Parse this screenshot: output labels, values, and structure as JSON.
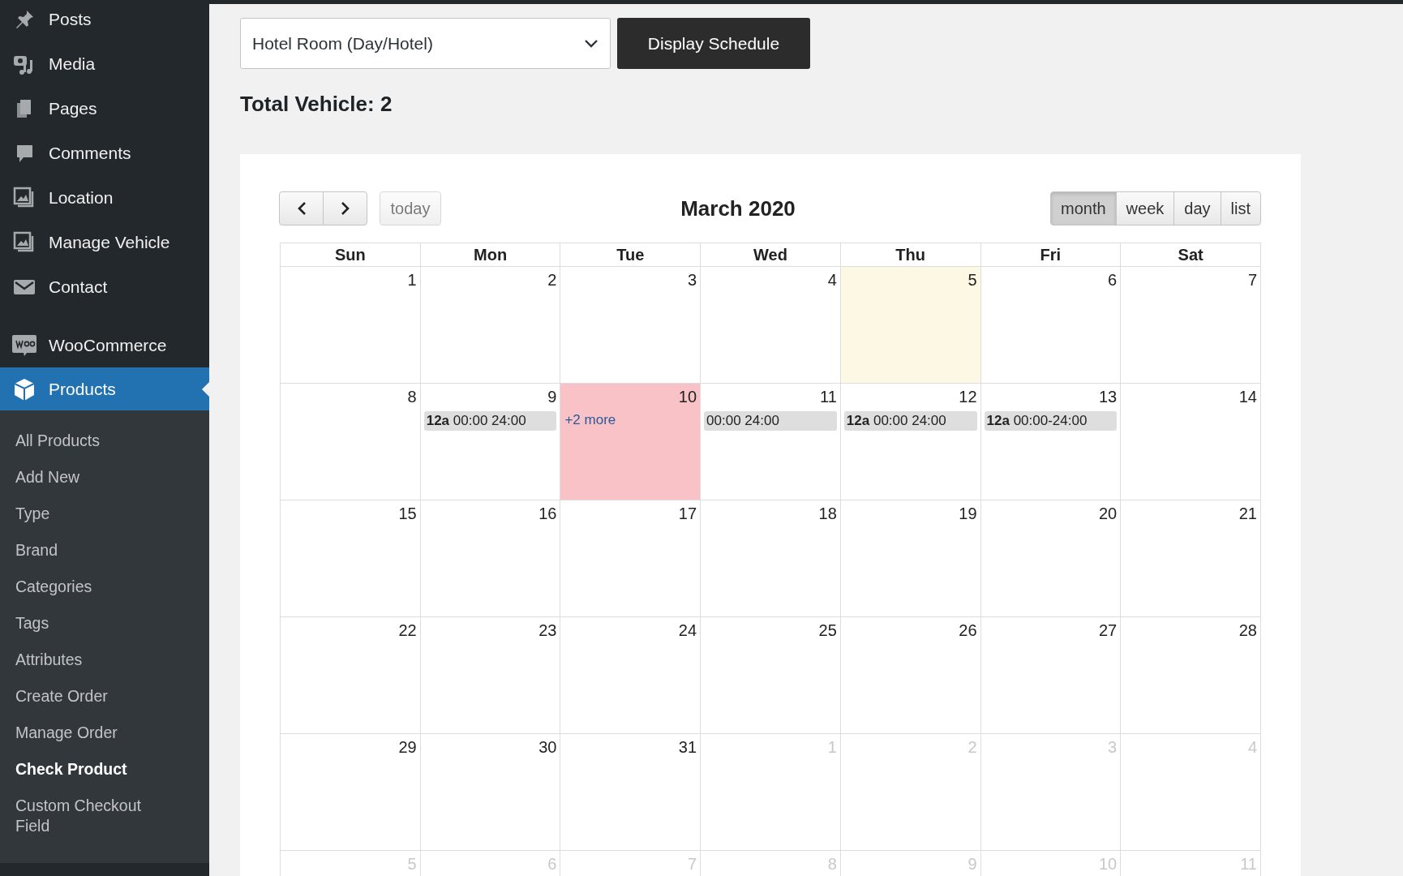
{
  "sidebar": {
    "menu": [
      {
        "label": "Posts",
        "selected": false
      },
      {
        "label": "Media",
        "selected": false
      },
      {
        "label": "Pages",
        "selected": false
      },
      {
        "label": "Comments",
        "selected": false
      },
      {
        "label": "Location",
        "selected": false
      },
      {
        "label": "Manage Vehicle",
        "selected": false
      },
      {
        "label": "Contact",
        "selected": false
      },
      {
        "label": "WooCommerce",
        "selected": false
      },
      {
        "label": "Products",
        "selected": true
      }
    ],
    "submenu": [
      {
        "label": "All Products",
        "selected": false
      },
      {
        "label": "Add New",
        "selected": false
      },
      {
        "label": "Type",
        "selected": false
      },
      {
        "label": "Brand",
        "selected": false
      },
      {
        "label": "Categories",
        "selected": false
      },
      {
        "label": "Tags",
        "selected": false
      },
      {
        "label": "Attributes",
        "selected": false
      },
      {
        "label": "Create Order",
        "selected": false
      },
      {
        "label": "Manage Order",
        "selected": false
      },
      {
        "label": "Check Product",
        "selected": true
      },
      {
        "label": "Custom Checkout Field",
        "selected": false
      }
    ]
  },
  "schedule": {
    "select": {
      "value": "Hotel Room (Day/Hotel)"
    },
    "button": "Display Schedule",
    "total": "Total Vehicle: 2"
  },
  "calendar": {
    "title": "March 2020",
    "today_button": "today",
    "views": [
      {
        "label": "month",
        "selected": true
      },
      {
        "label": "week",
        "selected": false
      },
      {
        "label": "day",
        "selected": false
      },
      {
        "label": "list",
        "selected": false
      }
    ],
    "weekdays": [
      "Sun",
      "Mon",
      "Tue",
      "Wed",
      "Thu",
      "Fri",
      "Sat"
    ],
    "weeks": [
      [
        {
          "day": "1",
          "other_month": false,
          "today": false,
          "booked": false
        },
        {
          "day": "2",
          "other_month": false,
          "today": false,
          "booked": false
        },
        {
          "day": "3",
          "other_month": false,
          "today": false,
          "booked": false
        },
        {
          "day": "4",
          "other_month": false,
          "today": false,
          "booked": false
        },
        {
          "day": "5",
          "other_month": false,
          "today": true,
          "booked": false
        },
        {
          "day": "6",
          "other_month": false,
          "today": false,
          "booked": false
        },
        {
          "day": "7",
          "other_month": false,
          "today": false,
          "booked": false
        }
      ],
      [
        {
          "day": "8",
          "other_month": false,
          "today": false,
          "booked": false
        },
        {
          "day": "9",
          "other_month": false,
          "today": false,
          "booked": false,
          "events": [
            {
              "time": "12a",
              "title": "00:00 24:00"
            }
          ]
        },
        {
          "day": "10",
          "other_month": false,
          "today": false,
          "booked": true,
          "more": "+2 more"
        },
        {
          "day": "11",
          "other_month": false,
          "today": false,
          "booked": false,
          "events": [
            {
              "title": "00:00 24:00"
            }
          ]
        },
        {
          "day": "12",
          "other_month": false,
          "today": false,
          "booked": false,
          "events": [
            {
              "time": "12a",
              "title": "00:00 24:00"
            }
          ]
        },
        {
          "day": "13",
          "other_month": false,
          "today": false,
          "booked": false,
          "events": [
            {
              "time": "12a",
              "title": "00:00-24:00"
            }
          ]
        },
        {
          "day": "14",
          "other_month": false,
          "today": false,
          "booked": false
        }
      ],
      [
        {
          "day": "15",
          "other_month": false,
          "today": false,
          "booked": false
        },
        {
          "day": "16",
          "other_month": false,
          "today": false,
          "booked": false
        },
        {
          "day": "17",
          "other_month": false,
          "today": false,
          "booked": false
        },
        {
          "day": "18",
          "other_month": false,
          "today": false,
          "booked": false
        },
        {
          "day": "19",
          "other_month": false,
          "today": false,
          "booked": false
        },
        {
          "day": "20",
          "other_month": false,
          "today": false,
          "booked": false
        },
        {
          "day": "21",
          "other_month": false,
          "today": false,
          "booked": false
        }
      ],
      [
        {
          "day": "22",
          "other_month": false,
          "today": false,
          "booked": false
        },
        {
          "day": "23",
          "other_month": false,
          "today": false,
          "booked": false
        },
        {
          "day": "24",
          "other_month": false,
          "today": false,
          "booked": false
        },
        {
          "day": "25",
          "other_month": false,
          "today": false,
          "booked": false
        },
        {
          "day": "26",
          "other_month": false,
          "today": false,
          "booked": false
        },
        {
          "day": "27",
          "other_month": false,
          "today": false,
          "booked": false
        },
        {
          "day": "28",
          "other_month": false,
          "today": false,
          "booked": false
        }
      ],
      [
        {
          "day": "29",
          "other_month": false,
          "today": false,
          "booked": false
        },
        {
          "day": "30",
          "other_month": false,
          "today": false,
          "booked": false
        },
        {
          "day": "31",
          "other_month": false,
          "today": false,
          "booked": false
        },
        {
          "day": "1",
          "other_month": true,
          "today": false,
          "booked": false
        },
        {
          "day": "2",
          "other_month": true,
          "today": false,
          "booked": false
        },
        {
          "day": "3",
          "other_month": true,
          "today": false,
          "booked": false
        },
        {
          "day": "4",
          "other_month": true,
          "today": false,
          "booked": false
        }
      ],
      [
        {
          "day": "5",
          "other_month": true,
          "today": false,
          "booked": false
        },
        {
          "day": "6",
          "other_month": true,
          "today": false,
          "booked": false
        },
        {
          "day": "7",
          "other_month": true,
          "today": false,
          "booked": false
        },
        {
          "day": "8",
          "other_month": true,
          "today": false,
          "booked": false
        },
        {
          "day": "9",
          "other_month": true,
          "today": false,
          "booked": false
        },
        {
          "day": "10",
          "other_month": true,
          "today": false,
          "booked": false
        },
        {
          "day": "11",
          "other_month": true,
          "today": false,
          "booked": false
        }
      ]
    ]
  }
}
